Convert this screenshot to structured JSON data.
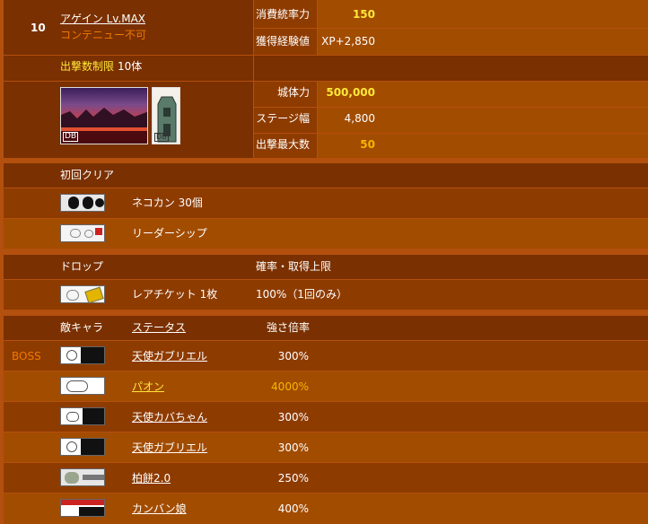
{
  "stage": {
    "number": "10",
    "name": "アゲイン Lv.MAX",
    "continue_note": "コンテニュー不可",
    "deploy_limit_label": "出撃数制限",
    "deploy_limit_value": "10体",
    "stats": [
      {
        "label": "消費統率力",
        "value": "150"
      },
      {
        "label": "獲得経験値",
        "value": "XP+2,850"
      },
      {
        "label": "城体力",
        "value": "500,000"
      },
      {
        "label": "ステージ幅",
        "value": "4,800"
      },
      {
        "label": "出撃最大数",
        "value": "50"
      }
    ],
    "bg_badge": "DB",
    "castle_badge": "DB"
  },
  "first_clear": {
    "header": "初回クリア",
    "items": [
      {
        "icon": "cat-food-icon",
        "label": "ネコカン 30個"
      },
      {
        "icon": "leadership-icon",
        "label": "リーダーシップ"
      }
    ]
  },
  "drop": {
    "header": "ドロップ",
    "rate_header": "確率・取得上限",
    "items": [
      {
        "icon": "rare-ticket-icon",
        "label": "レアチケット 1枚",
        "rate": "100%（1回のみ）"
      }
    ]
  },
  "enemies": {
    "header_enemy": "敵キャラ",
    "header_status": "ステータス",
    "header_mult": "強さ倍率",
    "rows": [
      {
        "boss": "BOSS",
        "name": "天使ガブリエル",
        "mult": "300%",
        "highlight": false
      },
      {
        "boss": "",
        "name": "パオン",
        "mult": "4000%",
        "highlight": true
      },
      {
        "boss": "",
        "name": "天使カバちゃん",
        "mult": "300%",
        "highlight": false
      },
      {
        "boss": "",
        "name": "天使ガブリエル",
        "mult": "300%",
        "highlight": false
      },
      {
        "boss": "",
        "name": "柏餅2.0",
        "mult": "250%",
        "highlight": false
      },
      {
        "boss": "",
        "name": "カンバン娘",
        "mult": "400%",
        "highlight": false
      }
    ]
  },
  "colors": {
    "page_bg": "#b3500e",
    "row_dark": "#7a3000",
    "row_mid": "#8e3b00",
    "row_light": "#a24c00",
    "value_yellow": "#ffe93a",
    "highlight_gold": "#f5b700",
    "boss_orange": "#f07800"
  }
}
